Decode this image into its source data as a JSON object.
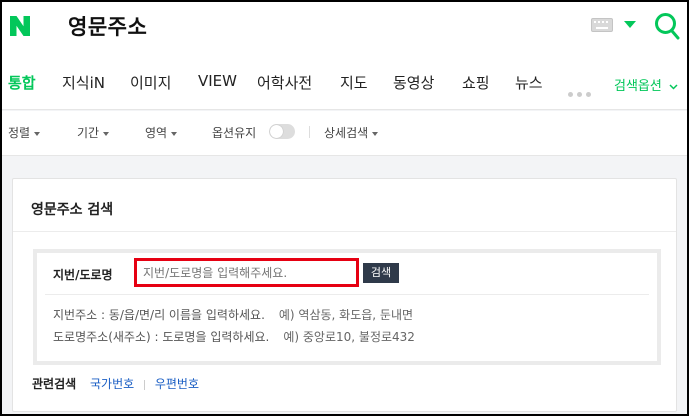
{
  "header": {
    "query": "영문주소",
    "logo_letter": "N"
  },
  "tabs": [
    {
      "label": "통합",
      "active": true
    },
    {
      "label": "지식iN"
    },
    {
      "label": "이미지"
    },
    {
      "label": "VIEW"
    },
    {
      "label": "어학사전"
    },
    {
      "label": "지도"
    },
    {
      "label": "동영상"
    },
    {
      "label": "쇼핑"
    },
    {
      "label": "뉴스"
    }
  ],
  "tab_option": "검색옵션",
  "filters": {
    "sort": "정렬",
    "period": "기간",
    "area": "영역",
    "keep_option": "옵션유지",
    "detail": "상세검색"
  },
  "card": {
    "title": "영문주소 검색",
    "row_label": "지번/도로명",
    "input_placeholder": "지번/도로명을 입력해주세요.",
    "input_value": "",
    "search_button": "검색",
    "help_lot": "지번주소 : 동/읍/면/리 이름을 입력하세요.",
    "help_lot_example": "예) 역삼동, 화도읍, 둔내면",
    "help_road": "도로명주소(새주소) : 도로명을 입력하세요.",
    "help_road_example": "예) 중앙로10, 불정로432"
  },
  "related": {
    "label": "관련검색",
    "links": [
      "국가번호",
      "우편번호"
    ]
  },
  "colors": {
    "brand_green": "#03c75a",
    "highlight_red": "#e60012",
    "button_dark": "#2f3a4a",
    "link_blue": "#1a5ec4"
  }
}
